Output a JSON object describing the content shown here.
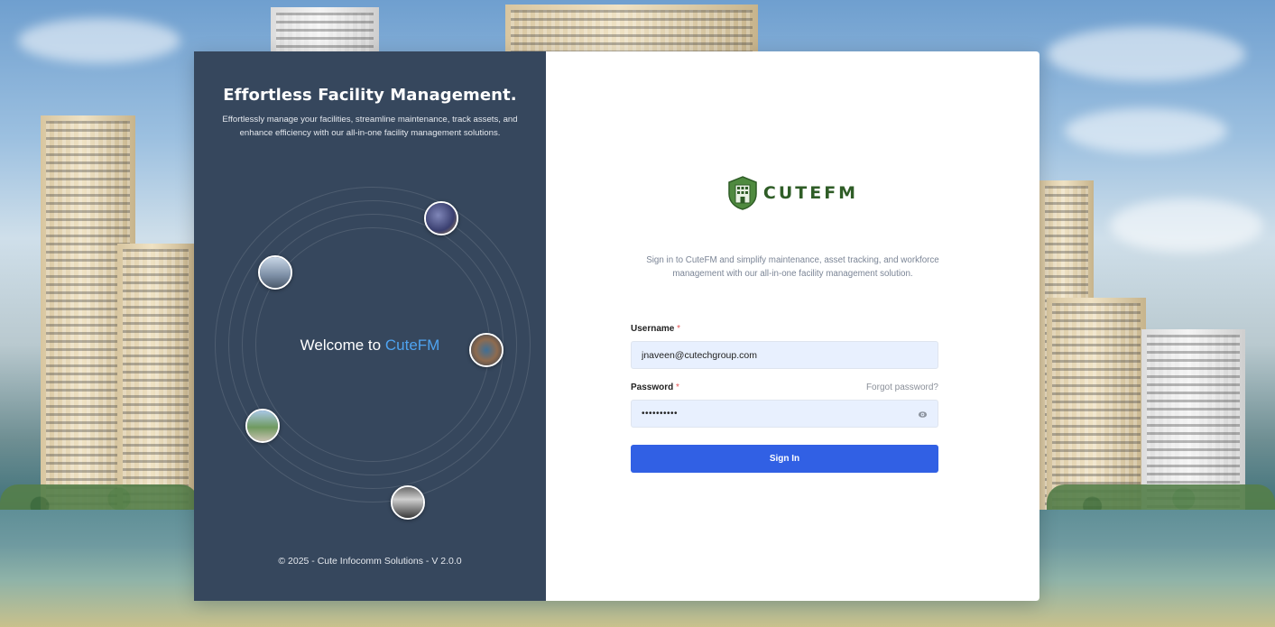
{
  "left_panel": {
    "headline": "Effortless Facility Management.",
    "subtext": "Effortlessly manage your facilities, streamline maintenance, track assets, and enhance efficiency with our all-in-one facility management solutions.",
    "welcome_prefix": "Welcome to",
    "welcome_brand": "CuteFM",
    "footer": "© 2025 - Cute Infocomm Solutions - V 2.0.0"
  },
  "right_panel": {
    "logo_text": "CUTEFM",
    "tagline": "Sign in to CuteFM and simplify maintenance, asset tracking, and workforce management with our all-in-one facility management solution.",
    "username_label": "Username",
    "username_value": "jnaveen@cutechgroup.com",
    "password_label": "Password",
    "password_value": "••••••••••",
    "required_mark": "*",
    "forgot_label": "Forgot password?",
    "signin_label": "Sign In"
  },
  "colors": {
    "panel_dark": "#36475d",
    "brand_blue": "#4ea3f0",
    "button": "#3160e4",
    "logo_green": "#2f5d27"
  }
}
